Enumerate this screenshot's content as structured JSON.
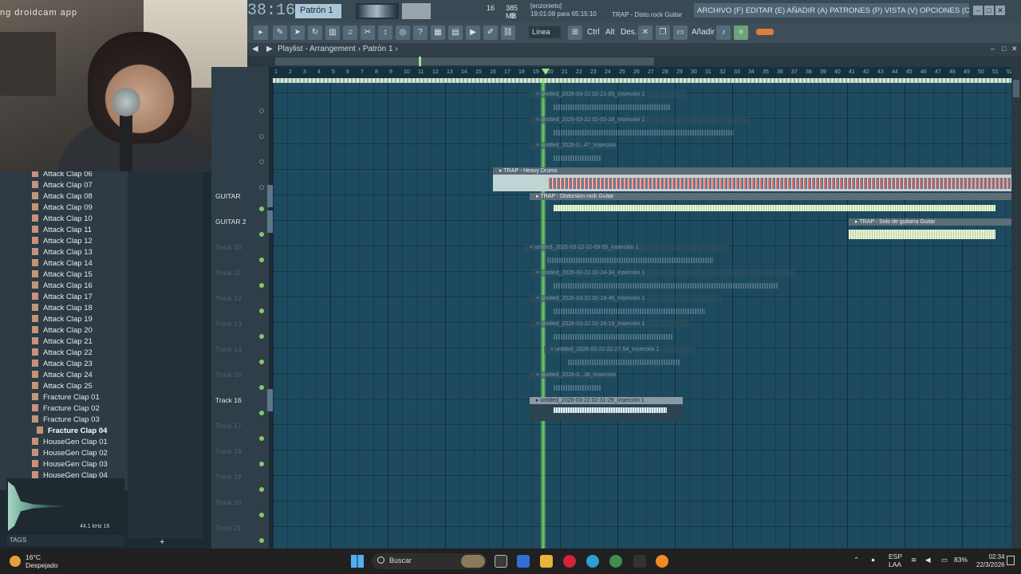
{
  "webcam": {
    "overlay_text": "ng droidcam app"
  },
  "topbar": {
    "time": "38:16",
    "pattern": "Patrón 1",
    "cpu_value": "16",
    "memory": "385 MB",
    "memory_sub": "0",
    "hint_line1": "[enzonieto]",
    "hint_line2": "19:01:08 para 65:15:10",
    "hint_right": "TRAP - Disto.rock Guitar",
    "menu": "ARCHIVO (F) EDITAR (E) AÑADIR (A) PATRONES (P) VISTA (V) OPCIONES (O) HERRAMIENTAS (T) AYUDA",
    "win_min": "–",
    "win_max": "□",
    "win_close": "✕"
  },
  "toolbar": {
    "snap": "Línea",
    "ctrl": "Ctrl",
    "alt": "Alt",
    "des": "Des.",
    "add": "Añadir"
  },
  "playlist": {
    "title": "Playlist - Arrangement › Patrón 1 ›",
    "ruler": [
      "1",
      "2",
      "3",
      "4",
      "5",
      "6",
      "7",
      "8",
      "9",
      "10",
      "11",
      "12",
      "13",
      "14",
      "15",
      "16",
      "17",
      "18",
      "19",
      "20",
      "21",
      "22",
      "23",
      "24",
      "25",
      "26",
      "27",
      "28",
      "29",
      "30",
      "31",
      "32",
      "33",
      "34",
      "35",
      "36",
      "37",
      "38",
      "39",
      "40",
      "41",
      "42",
      "43",
      "44",
      "45",
      "46",
      "47",
      "48",
      "49",
      "50",
      "51",
      "52"
    ]
  },
  "tracks": [
    {
      "name": "GUITAR",
      "active": true
    },
    {
      "name": "GUITAR 2",
      "active": true
    },
    {
      "name": "Track 10",
      "active": false
    },
    {
      "name": "Track 11",
      "active": false
    },
    {
      "name": "Track 12",
      "active": false
    },
    {
      "name": "Track 13",
      "active": false
    },
    {
      "name": "Track 14",
      "active": false
    },
    {
      "name": "Track 15",
      "active": false
    },
    {
      "name": "Track 16",
      "active": true
    },
    {
      "name": "Track 17",
      "active": false
    },
    {
      "name": "Track 18",
      "active": false
    },
    {
      "name": "Track 19",
      "active": false
    },
    {
      "name": "Track 20",
      "active": false
    },
    {
      "name": "Track 21",
      "active": false
    }
  ],
  "clips": {
    "c1": "× untitled_2026-03-22 02-21-05_Inserción 1",
    "c2": "× untitled_2026-03-22 02-03-28_Inserción 1",
    "c3": "× untitled_2026-0...47_Inserción 1",
    "drums": "▸ TRAP - Heavy Drums",
    "gtr1": "▸ TRAP - Distorsion rock Guitar",
    "gtr2": "▸ TRAP - Solo de guitarra Guitar",
    "c10": "× untitled_2026-03-22 02-09-55_Inserción 1",
    "c11": "× untitled_2026-03-22 02-24-34_Inserción 1",
    "c12": "× untitled_2026-03-22 02-18-45_Inserción 1",
    "c13": "× untitled_2026-03-22 02-26-19_Inserción 1",
    "c14": "× untitled_2026-03-22 02-27-54_Inserción 1",
    "c15": "× untitled_2026-0...38_Inserción 1",
    "c16": "▸ untitled_2026-03-22 02-31-29_Inserción 1"
  },
  "browser": {
    "items": [
      "Attack Clap 06",
      "Attack Clap 07",
      "Attack Clap 08",
      "Attack Clap 09",
      "Attack Clap 10",
      "Attack Clap 11",
      "Attack Clap 12",
      "Attack Clap 13",
      "Attack Clap 14",
      "Attack Clap 15",
      "Attack Clap 16",
      "Attack Clap 17",
      "Attack Clap 18",
      "Attack Clap 19",
      "Attack Clap 20",
      "Attack Clap 21",
      "Attack Clap 22",
      "Attack Clap 23",
      "Attack Clap 24",
      "Attack Clap 25",
      "Fracture Clap 01",
      "Fracture Clap 02",
      "Fracture Clap 03",
      "Fracture Clap 04",
      "HouseGen Clap 01",
      "HouseGen Clap 02",
      "HouseGen Clap 03",
      "HouseGen Clap 04"
    ],
    "selected_index": 23,
    "preview_info": "44.1 kHz 16",
    "tags_label": "TAGS",
    "add": "+"
  },
  "taskbar": {
    "temp": "16°C",
    "weather": "Despejado",
    "search": "Buscar",
    "lang1": "ESP",
    "lang2": "LAA",
    "battery": "83%",
    "time": "02:34",
    "date": "22/3/2026"
  }
}
